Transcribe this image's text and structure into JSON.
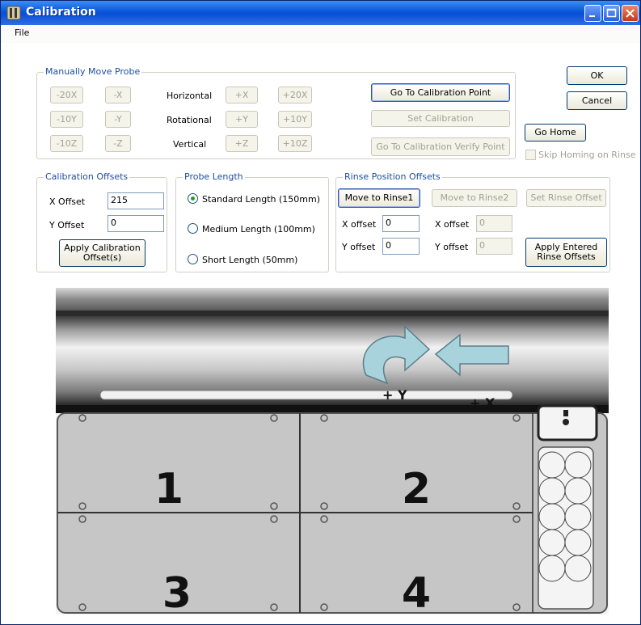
{
  "window": {
    "title": "Calibration"
  },
  "menu": {
    "file": "File"
  },
  "manual": {
    "legend": "Manually Move Probe",
    "neg_buttons": [
      [
        "-20X",
        "-X"
      ],
      [
        "-10Y",
        "-Y"
      ],
      [
        "-10Z",
        "-Z"
      ]
    ],
    "axis_labels": [
      "Horizontal",
      "Rotational",
      "Vertical"
    ],
    "pos_buttons": [
      [
        "+X",
        "+20X"
      ],
      [
        "+Y",
        "+10Y"
      ],
      [
        "+Z",
        "+10Z"
      ]
    ],
    "go_to_cal": "Go To Calibration Point",
    "set_cal": "Set Calibration",
    "go_to_verify": "Go To Calibration Verify Point"
  },
  "dialog": {
    "ok": "OK",
    "cancel": "Cancel",
    "go_home": "Go Home",
    "skip_homing": "Skip Homing on Rinse"
  },
  "cal_offsets": {
    "legend": "Calibration Offsets",
    "x_label": "X Offset",
    "x_value": "215",
    "y_label": "Y Offset",
    "y_value": "0",
    "apply": "Apply Calibration Offset(s)"
  },
  "probe_length": {
    "legend": "Probe Length",
    "options": [
      "Standard Length (150mm)",
      "Medium Length (100mm)",
      "Short Length (50mm)"
    ],
    "selected": "Standard Length (150mm)"
  },
  "rinse": {
    "legend": "Rinse Position Offsets",
    "move1": "Move to Rinse1",
    "move2": "Move to Rinse2",
    "set": "Set Rinse Offset",
    "x1_label": "X offset",
    "x1_value": "0",
    "y1_label": "Y offset",
    "y1_value": "0",
    "x2_label": "X offset",
    "x2_value": "0",
    "y2_label": "Y offset",
    "y2_value": "0",
    "apply": "Apply Entered Rinse Offsets"
  },
  "diagram": {
    "rotate_label": "+ Y",
    "move_label": "+ X",
    "quadrants": [
      "1",
      "2",
      "3",
      "4"
    ]
  }
}
